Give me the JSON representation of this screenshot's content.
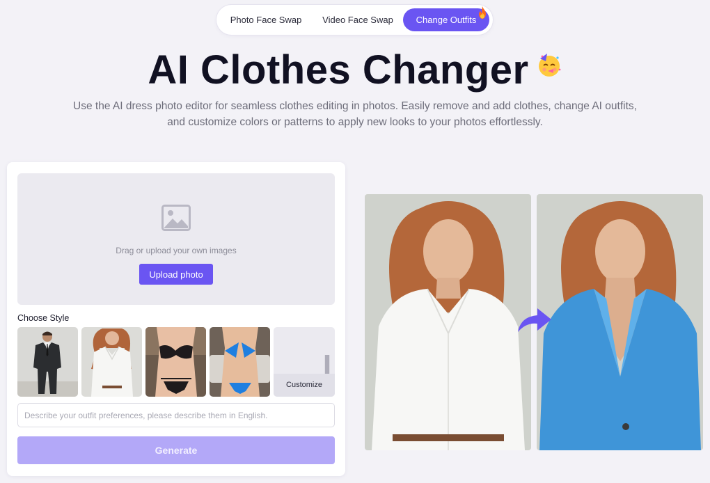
{
  "tabs": [
    {
      "label": "Photo Face Swap",
      "active": false
    },
    {
      "label": "Video Face Swap",
      "active": false
    },
    {
      "label": "Change Outfits",
      "active": true
    }
  ],
  "hero": {
    "title": "AI Clothes Changer",
    "subtitle_line1": "Use the AI dress photo editor for seamless clothes editing in photos. Easily remove and add clothes, change AI outfits,",
    "subtitle_line2": "and customize colors or patterns to apply new looks to your photos effortlessly."
  },
  "uploader": {
    "drop_text": "Drag or upload your own images",
    "upload_label": "Upload photo"
  },
  "styles": {
    "heading": "Choose Style",
    "items": [
      {
        "name": "black suit",
        "icon": "suit"
      },
      {
        "name": "white shirt",
        "icon": "shirt"
      },
      {
        "name": "black lingerie",
        "icon": "lingerie"
      },
      {
        "name": "blue bikini",
        "icon": "bikini"
      }
    ],
    "customize_label": "Customize"
  },
  "prompt": {
    "placeholder": "Describe your outfit preferences, please describe them in English."
  },
  "generate_label": "Generate",
  "colors": {
    "accent": "#6a55f2",
    "accent_disabled": "#b3a8f8",
    "background": "#f3f2f7"
  }
}
